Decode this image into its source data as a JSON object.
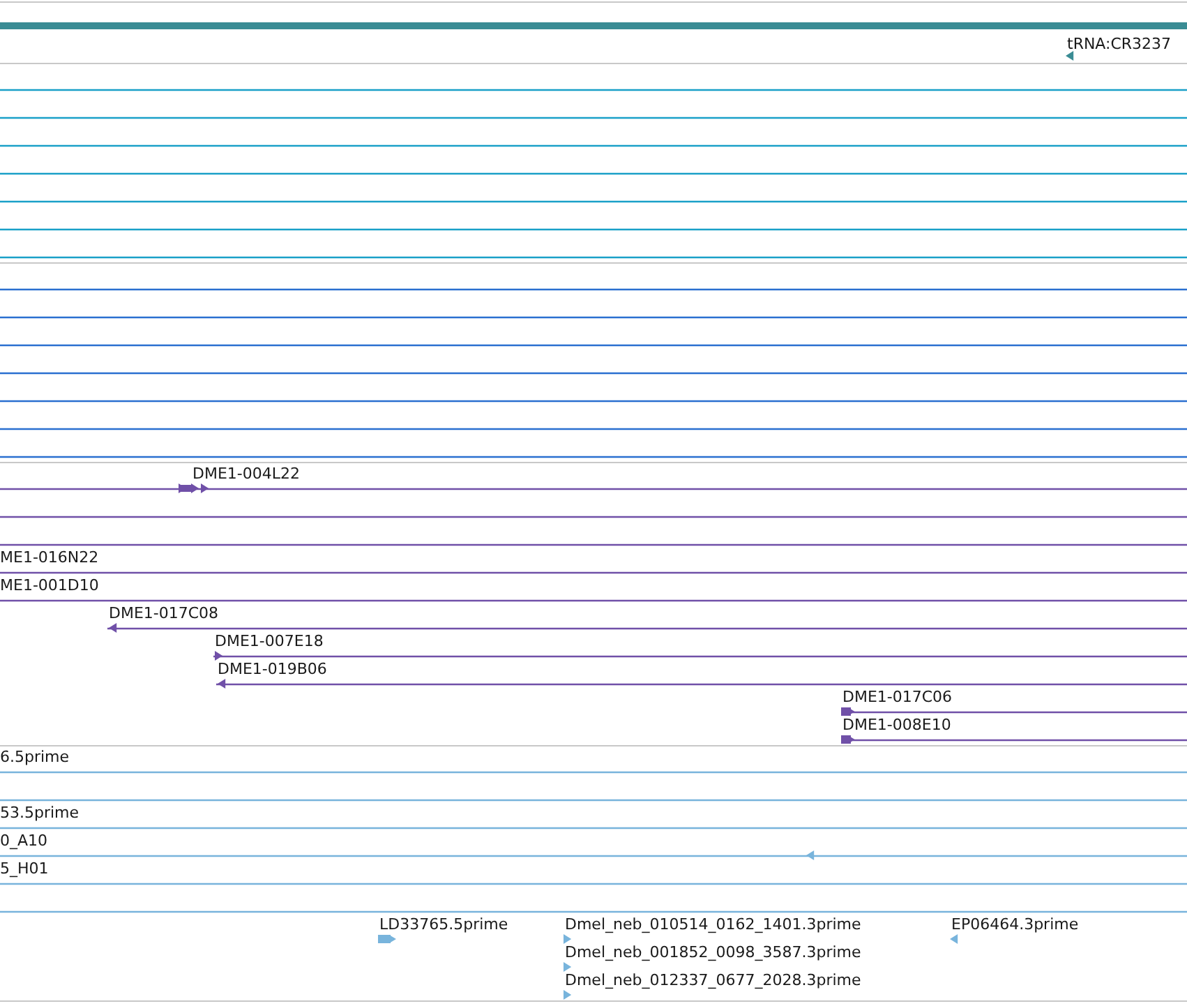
{
  "tracks": [
    {
      "color": "#3a8c94",
      "rows": [
        {
          "features": [
            {
              "arrow": false
            }
          ]
        },
        {
          "features": [
            {
              "label": "tRNA:CR3237",
              "arrow": true,
              "reverse": true
            }
          ]
        }
      ]
    },
    {
      "color": "#1aa0c8",
      "rows": [
        {
          "features": [
            {
              "arrow": false
            }
          ]
        },
        {
          "features": [
            {
              "arrow": false
            }
          ]
        },
        {
          "features": [
            {
              "arrow": false
            }
          ]
        },
        {
          "features": [
            {
              "arrow": false
            }
          ]
        },
        {
          "features": [
            {
              "arrow": false
            }
          ]
        },
        {
          "features": [
            {
              "arrow": false
            }
          ]
        },
        {
          "features": [
            {
              "arrow": false
            }
          ]
        }
      ]
    },
    {
      "color": "#2a6fd0",
      "rows": [
        {
          "features": [
            {
              "arrow": false
            }
          ]
        },
        {
          "features": [
            {
              "arrow": false
            }
          ]
        },
        {
          "features": [
            {
              "arrow": false
            }
          ]
        },
        {
          "features": [
            {
              "arrow": false
            }
          ]
        },
        {
          "features": [
            {
              "arrow": false
            }
          ]
        },
        {
          "features": [
            {
              "arrow": false
            }
          ]
        },
        {
          "features": [
            {
              "arrow": false
            }
          ]
        }
      ]
    },
    {
      "color": "#7050a8",
      "rows": [
        {
          "features": [
            {
              "label": "DME1-004L22",
              "arrow": true,
              "reverse": false
            }
          ]
        },
        {
          "features": [
            {
              "arrow": false
            }
          ]
        },
        {
          "features": [
            {
              "arrow": false
            }
          ]
        },
        {
          "features": [
            {
              "label": "ME1-016N22",
              "arrow": false
            }
          ]
        },
        {
          "features": [
            {
              "label": "ME1-001D10",
              "arrow": false
            }
          ]
        },
        {
          "features": [
            {
              "label": "DME1-017C08",
              "arrow": true,
              "reverse": true
            }
          ]
        },
        {
          "features": [
            {
              "label": "DME1-007E18",
              "arrow": true,
              "reverse": false
            }
          ]
        },
        {
          "features": [
            {
              "label": "DME1-019B06",
              "arrow": true,
              "reverse": true
            }
          ]
        },
        {
          "features": [
            {
              "label": "DME1-017C06",
              "arrow": true,
              "reverse": false
            }
          ]
        },
        {
          "features": [
            {
              "label": "DME1-008E10",
              "arrow": true,
              "reverse": false
            }
          ]
        }
      ]
    },
    {
      "color": "#78b4dc",
      "rows": [
        {
          "features": [
            {
              "label": "6.5prime",
              "arrow": false
            }
          ]
        },
        {
          "features": [
            {
              "arrow": false
            }
          ]
        },
        {
          "features": [
            {
              "label": "53.5prime",
              "arrow": false
            }
          ]
        },
        {
          "features": [
            {
              "label": "0_A10",
              "arrow": true,
              "reverse": true
            }
          ]
        },
        {
          "features": [
            {
              "label": "5_H01",
              "arrow": false
            }
          ]
        },
        {
          "features": [
            {
              "arrow": false
            }
          ]
        },
        {
          "features": [
            {
              "label": "LD33765.5prime",
              "arrow": true,
              "reverse": false
            },
            {
              "label": "Dmel_neb_010514_0162_1401.3prime",
              "arrow": true,
              "reverse": false
            },
            {
              "label": "EP06464.3prime",
              "arrow": true,
              "reverse": true
            }
          ]
        },
        {
          "features": [
            {
              "label": "Dmel_neb_001852_0098_3587.3prime",
              "arrow": true,
              "reverse": false
            }
          ]
        },
        {
          "features": [
            {
              "label": "Dmel_neb_012337_0677_2028.3prime",
              "arrow": true,
              "reverse": false
            }
          ]
        }
      ]
    }
  ]
}
